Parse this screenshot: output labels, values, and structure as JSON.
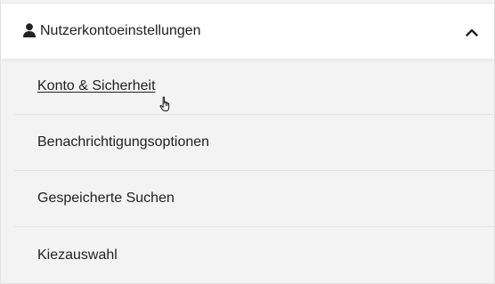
{
  "header": {
    "title": "Nutzerkontoeinstellungen",
    "icon": "user-icon",
    "toggle_icon": "chevron-up-icon",
    "expanded": true
  },
  "menu": {
    "items": [
      {
        "label": "Konto & Sicherheit",
        "state": "hovered"
      },
      {
        "label": "Benachrichtigungsoptionen"
      },
      {
        "label": "Gespeicherte Suchen"
      },
      {
        "label": "Kiezauswahl"
      }
    ]
  },
  "colors": {
    "text": "#222222",
    "header_bg": "#ffffff",
    "menu_bg": "#f3f3f3",
    "divider": "#e5e5e5"
  },
  "cursor": {
    "type": "hand-pointer-cursor"
  }
}
